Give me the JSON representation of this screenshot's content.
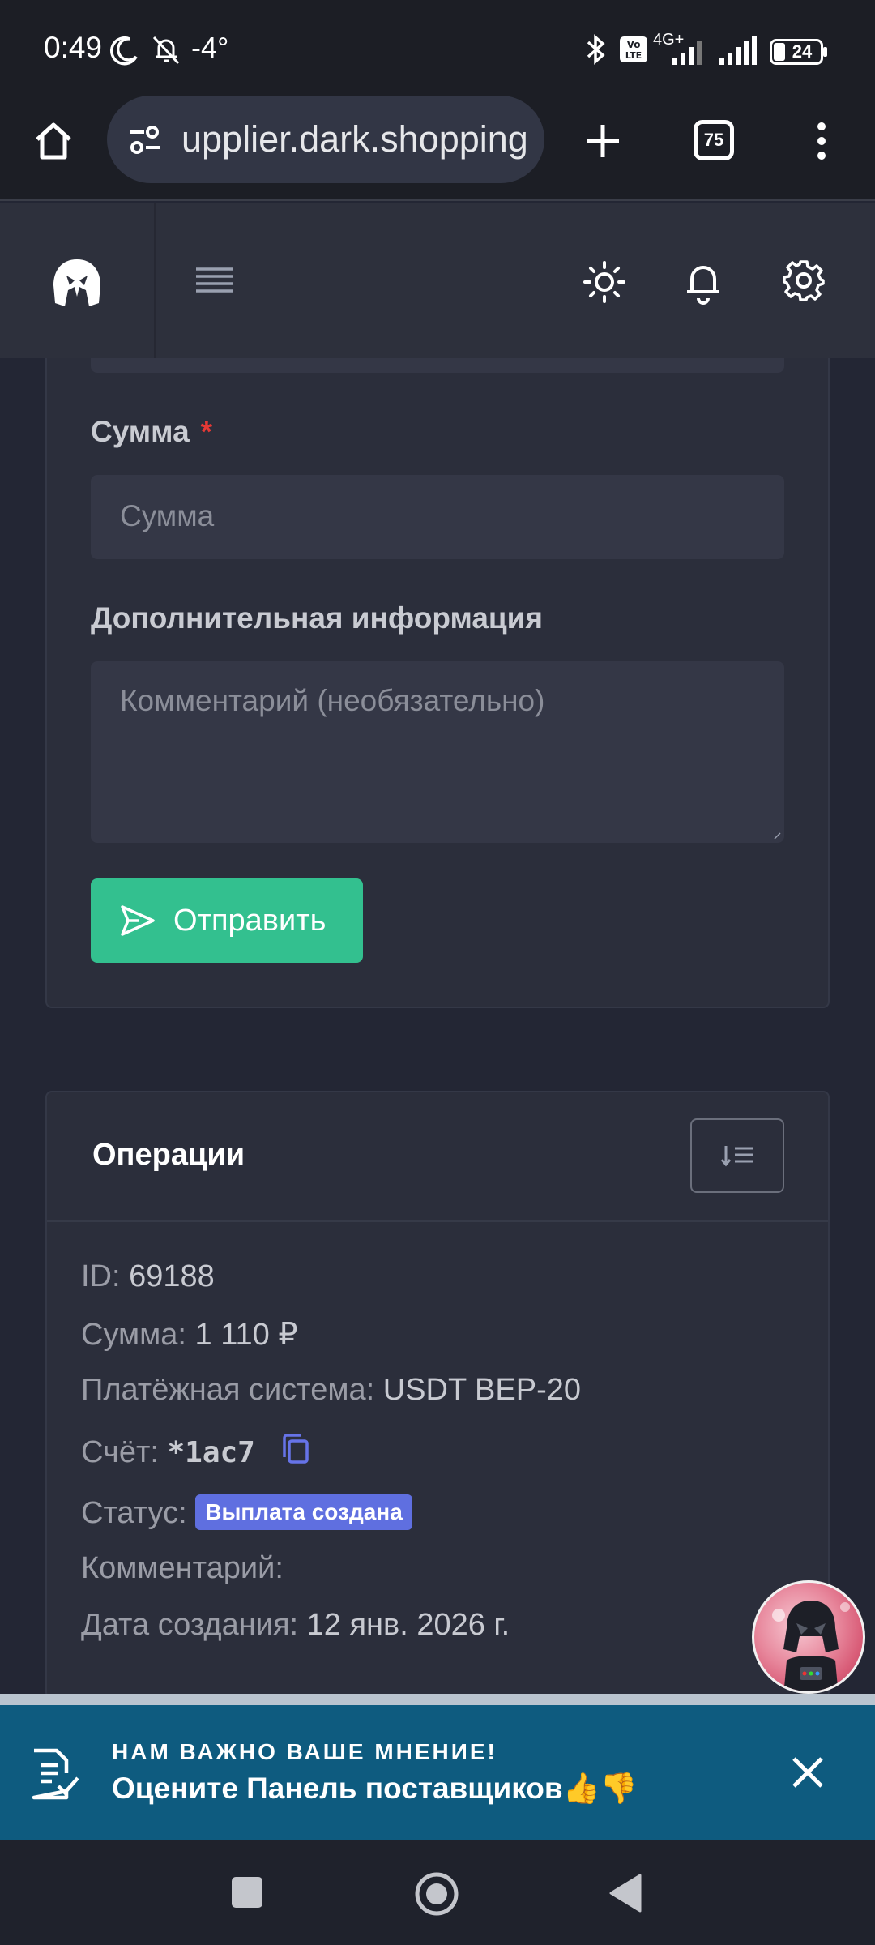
{
  "status_bar": {
    "time": "0:49",
    "temperature": "-4°",
    "battery": "24",
    "network": "4G+"
  },
  "browser": {
    "url": "upplier.dark.shopping",
    "tab_count": "75"
  },
  "form": {
    "amount_label": "Сумма",
    "required_mark": "*",
    "amount_placeholder": "Сумма",
    "info_label": "Дополнительная информация",
    "comment_placeholder": "Комментарий (необязательно)",
    "submit_label": "Отправить"
  },
  "operations": {
    "title": "Операции",
    "items": [
      {
        "id_label": "ID:",
        "id_value": "69188",
        "amount_label": "Сумма:",
        "amount_value": "1 110 ₽",
        "system_label": "Платёжная система:",
        "system_value": "USDT BEP-20",
        "account_label": "Счёт:",
        "account_value": "*1ac7",
        "status_label": "Статус:",
        "status_value": "Выплата создана",
        "comment_label": "Комментарий:",
        "date_label": "Дата создания:",
        "date_value": "12 янв. 2026 г."
      }
    ]
  },
  "banner": {
    "kicker": "НАМ ВАЖНО ВАШЕ МНЕНИЕ!",
    "title": "Оцените Панель поставщиков👍👎"
  },
  "colors": {
    "accent_green": "#33c08f",
    "badge_blue": "#5f6fe0",
    "banner_blue": "#0e5b7f",
    "required_red": "#e53935"
  }
}
